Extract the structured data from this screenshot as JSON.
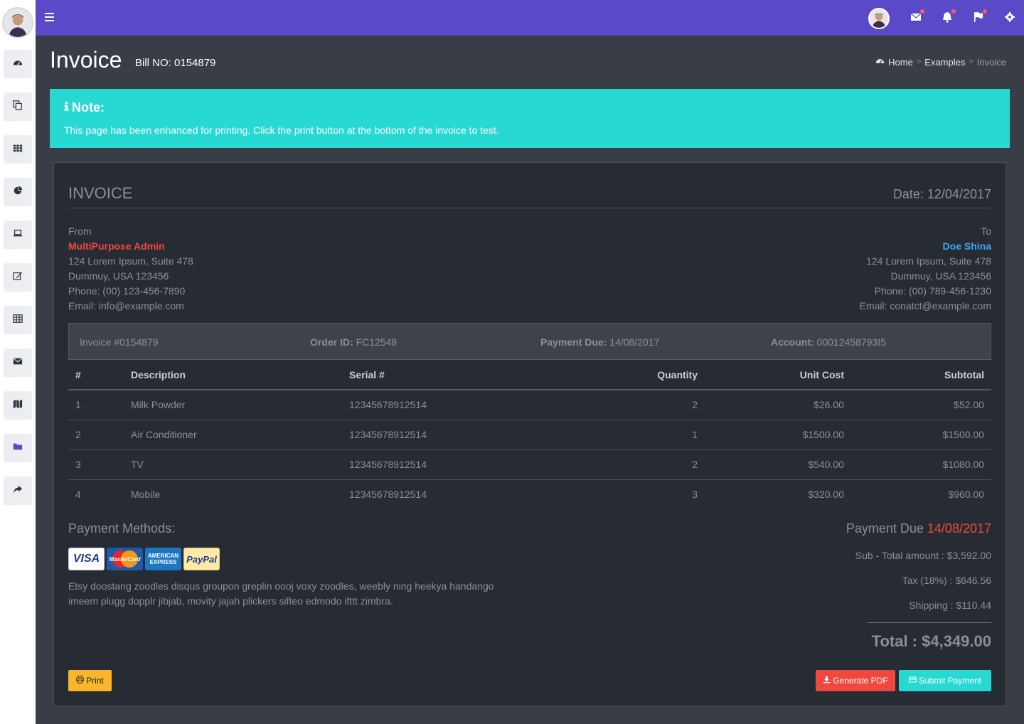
{
  "page": {
    "title": "Invoice",
    "subtitle": "Bill NO: 0154879"
  },
  "breadcrumb": {
    "items": [
      "Home",
      "Examples",
      "Invoice"
    ],
    "separator": ">"
  },
  "note": {
    "title": "Note:",
    "text": "This page has been enhanced for printing. Click the print button at the bottom of the invoice to test."
  },
  "sidebar": {
    "items": [
      {
        "icon": "dashboard-icon"
      },
      {
        "icon": "copy-icon"
      },
      {
        "icon": "grid-icon"
      },
      {
        "icon": "pie-chart-icon"
      },
      {
        "icon": "laptop-icon"
      },
      {
        "icon": "edit-icon"
      },
      {
        "icon": "table-icon"
      },
      {
        "icon": "envelope-icon"
      },
      {
        "icon": "map-icon"
      },
      {
        "icon": "folder-icon"
      },
      {
        "icon": "share-icon"
      }
    ]
  },
  "topbar": {
    "icons": [
      "menu-icon",
      "avatar",
      "envelope-icon",
      "bell-icon",
      "flag-icon",
      "gear-icon"
    ]
  },
  "invoice": {
    "heading": "INVOICE",
    "date": "Date: 12/04/2017",
    "from": {
      "label": "From",
      "name": "MultiPurpose Admin",
      "address1": "124 Lorem Ipsum, Suite 478",
      "address2": "Dummuy, USA 123456",
      "phone": "Phone: (00) 123-456-7890",
      "email": "Email: info@example.com"
    },
    "to": {
      "label": "To",
      "name": "Doe Shina",
      "address1": "124 Lorem Ipsum, Suite 478",
      "address2": "Dummuy, USA 123456",
      "phone": "Phone: (00) 789-456-1230",
      "email": "Email: conatct@example.com"
    },
    "meta": {
      "invoice_no": "Invoice #0154879",
      "order_id_label": "Order ID:",
      "order_id": "FC12548",
      "payment_due_label": "Payment Due:",
      "payment_due": "14/08/2017",
      "account_label": "Account:",
      "account": "00012458793I5"
    },
    "table": {
      "headers": [
        "#",
        "Description",
        "Serial #",
        "Quantity",
        "Unit Cost",
        "Subtotal"
      ],
      "rows": [
        [
          "1",
          "Milk Powder",
          "12345678912514",
          "2",
          "$26.00",
          "$52.00"
        ],
        [
          "2",
          "Air Conditioner",
          "12345678912514",
          "1",
          "$1500.00",
          "$1500.00"
        ],
        [
          "3",
          "TV",
          "12345678912514",
          "2",
          "$540.00",
          "$1080.00"
        ],
        [
          "4",
          "Mobile",
          "12345678912514",
          "3",
          "$320.00",
          "$960.00"
        ]
      ]
    },
    "payment_methods": {
      "title": "Payment Methods:",
      "cards": [
        "VISA",
        "MasterCard",
        "AMERICAN EXPRESS",
        "PayPal"
      ],
      "text": "Etsy doostang zoodles disqus groupon greplin oooj voxy zoodles, weebly ning heekya handango imeem plugg dopplr jibjab, movity jajah plickers sifteo edmodo ifttt zimbra."
    },
    "summary": {
      "due_label": "Payment Due",
      "due_date": "14/08/2017",
      "subtotal": "Sub - Total amount : $3,592.00",
      "tax": "Tax (18%) : $646.56",
      "shipping": "Shipping : $110.44",
      "total": "Total : $4,349.00"
    },
    "buttons": {
      "print": "Print",
      "pdf": "Generate PDF",
      "pay": "Submit Payment"
    }
  },
  "colors": {
    "topbar": "#5b4ac8",
    "note": "#27d9d2",
    "panel": "#272b33",
    "background": "#383d46",
    "accent_red": "#f0483e",
    "accent_blue": "#3da8f0",
    "print_button": "#f9b62a"
  }
}
